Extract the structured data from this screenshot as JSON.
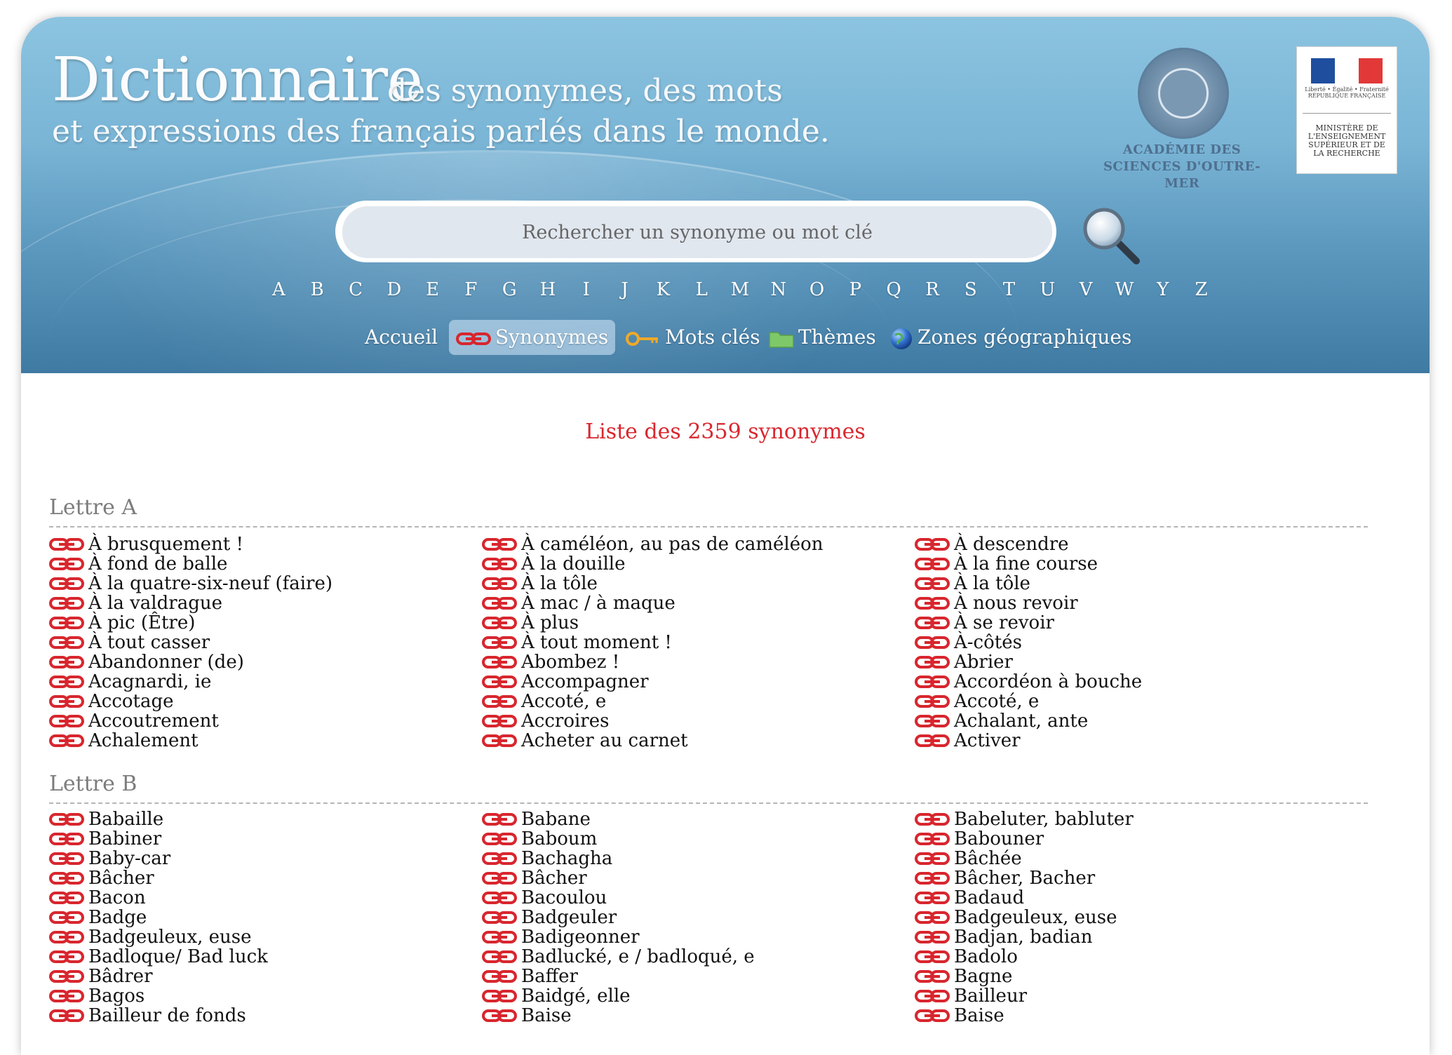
{
  "header": {
    "title_main": "Dictionnaire",
    "title_line1_rest": "des synonymes,  des mots",
    "title_line2": "et expressions des français parlés dans le monde.",
    "academie": [
      "ACADÉMIE DES",
      "SCIENCES D'OUTRE-MER"
    ],
    "ministere_flag_caption": "Liberté • Égalité • Fraternité  RÉPUBLIQUE FRANÇAISE",
    "ministere_text": [
      "MINISTÈRE DE",
      "L'ENSEIGNEMENT",
      "SUPÉRIEUR ET DE",
      "LA RECHERCHE"
    ]
  },
  "search": {
    "placeholder": "Rechercher un synonyme ou mot clé"
  },
  "alphabet": [
    "A",
    "B",
    "C",
    "D",
    "E",
    "F",
    "G",
    "H",
    "I",
    "J",
    "K",
    "L",
    "M",
    "N",
    "O",
    "P",
    "Q",
    "R",
    "S",
    "T",
    "U",
    "V",
    "W",
    "Y",
    "Z"
  ],
  "nav": {
    "accueil": "Accueil",
    "synonymes": "Synonymes",
    "mots_cles": "Mots clés",
    "themes": "Thèmes",
    "zones": "Zones géographiques"
  },
  "content": {
    "list_title": "Liste des 2359 synonymes",
    "sections": [
      {
        "heading": "Lettre A",
        "columns": [
          [
            "À brusquement !",
            "À fond de balle",
            "À la quatre-six-neuf (faire)",
            "À la valdrague",
            "À pic (Être)",
            "À tout casser",
            "Abandonner (de)",
            "Acagnardi, ie",
            "Accotage",
            "Accoutrement",
            "Achalement"
          ],
          [
            "À caméléon, au pas de caméléon",
            "À la douille",
            "À la tôle",
            "À mac / à maque",
            "À plus",
            "À tout moment !",
            "Abombez !",
            "Accompagner",
            "Accoté, e",
            "Accroires",
            "Acheter au carnet"
          ],
          [
            "À descendre",
            "À la fine course",
            "À la tôle",
            "À nous revoir",
            "À se revoir",
            "À-côtés",
            "Abrier",
            "Accordéon à bouche",
            "Accoté, e",
            "Achalant, ante",
            "Activer"
          ]
        ]
      },
      {
        "heading": "Lettre B",
        "columns": [
          [
            "Babaille",
            "Babiner",
            "Baby-car",
            "Bâcher",
            "Bacon",
            "Badge",
            "Badgeuleux, euse",
            "Badloque/ Bad luck",
            "Bâdrer",
            "Bagos",
            "Bailleur de fonds"
          ],
          [
            "Babane",
            "Baboum",
            "Bachagha",
            "Bâcher",
            "Bacoulou",
            "Badgeuler",
            "Badigeonner",
            "Badlucké, e / badloqué, e",
            "Baffer",
            "Baidgé, elle",
            "Baise"
          ],
          [
            "Babeluter, babluter",
            "Babouner",
            "Bâchée",
            "Bâcher, Bacher",
            "Badaud",
            "Badgeuleux, euse",
            "Badjan, badian",
            "Badolo",
            "Bagne",
            "Bailleur",
            "Baise"
          ]
        ]
      }
    ]
  }
}
